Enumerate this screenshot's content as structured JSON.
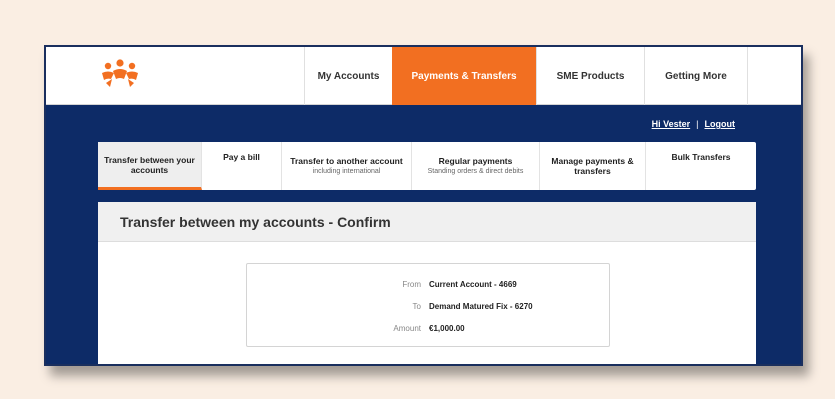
{
  "header": {
    "nav": [
      {
        "label": "My Accounts",
        "active": false
      },
      {
        "label": "Payments & Transfers",
        "active": true
      },
      {
        "label": "SME Products",
        "active": false
      },
      {
        "label": "Getting More",
        "active": false
      }
    ],
    "greeting": "Hi Vester",
    "logout_label": "Logout"
  },
  "subnav": [
    {
      "title": "Transfer between your accounts",
      "subtitle": "",
      "active": true
    },
    {
      "title": "Pay a bill",
      "subtitle": "",
      "active": false
    },
    {
      "title": "Transfer to another account",
      "subtitle": "including international",
      "active": false
    },
    {
      "title": "Regular payments",
      "subtitle": "Standing orders & direct debits",
      "active": false
    },
    {
      "title": "Manage payments & transfers",
      "subtitle": "",
      "active": false
    },
    {
      "title": "Bulk Transfers",
      "subtitle": "",
      "active": false
    }
  ],
  "panel": {
    "title": "Transfer between my accounts - Confirm",
    "rows": [
      {
        "label": "From",
        "value": "Current Account - 4669"
      },
      {
        "label": "To",
        "value": "Demand Matured Fix - 6270"
      },
      {
        "label": "Amount",
        "value": "€1,000.00"
      }
    ]
  },
  "colors": {
    "accent": "#f26f21",
    "navy": "#0d2b67",
    "background": "#faeee3"
  }
}
